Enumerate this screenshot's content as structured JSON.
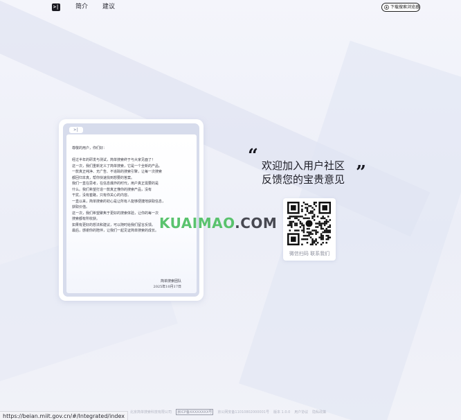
{
  "nav": {
    "logo": ">|",
    "intro": "简介",
    "suggest": "建议",
    "download": "下载搜索浏览器"
  },
  "letter": {
    "badge": ">|",
    "lines": [
      "尊敬的用户，你们好：",
      "",
      "经过半年的研发与测试，简单搜索终于与大家见面了！",
      "这一次，我们重新定义了简单搜索，它是一个全新的产品。",
      "一款真正纯净、无广告、不追踪的搜索引擎，让每一次搜索",
      "都回归本真，帮你快速找到想要的答案。",
      "我们一直在思考，在信息爆炸的时代，用户真正需要的是",
      "什么。我们希望打造一款真正懂你的搜索产品，没有",
      "干扰，没有套路，只有你关心的内容。",
      "一直以来，简单搜索的初心是让所有人能够便捷地获取信息，",
      "获取价值。",
      "这一次，我们希望聚焦于更好的搜索体验，让你的每一次",
      "搜索都有所收获。",
      "如果有更好的想法和建议，可以随时给我们留言反馈。",
      "最后，感谢你的陪伴，让我们一起见证简单搜索的成长。"
    ],
    "sign_team": "简单搜索团队",
    "sign_date": "2025年10月17日"
  },
  "slogan": {
    "quote_open": "“",
    "quote_close": "”",
    "line1": "欢迎加入用户社区",
    "line2": "反馈您的宝贵意见"
  },
  "qr": {
    "caption": "微信扫码  联系我们"
  },
  "watermark": {
    "green": "KUAIMAO",
    "dark": ".COM"
  },
  "footer": {
    "company": "北京简单搜索科技有限公司",
    "icp": "京ICP备XXXXXXXX号",
    "police": "京公网安备11010802000001号",
    "version": "版本 1.0.0",
    "terms": "用户协议",
    "privacy": "隐私政策"
  },
  "status_url": "https://beian.miit.gov.cn/#/Integrated/index"
}
